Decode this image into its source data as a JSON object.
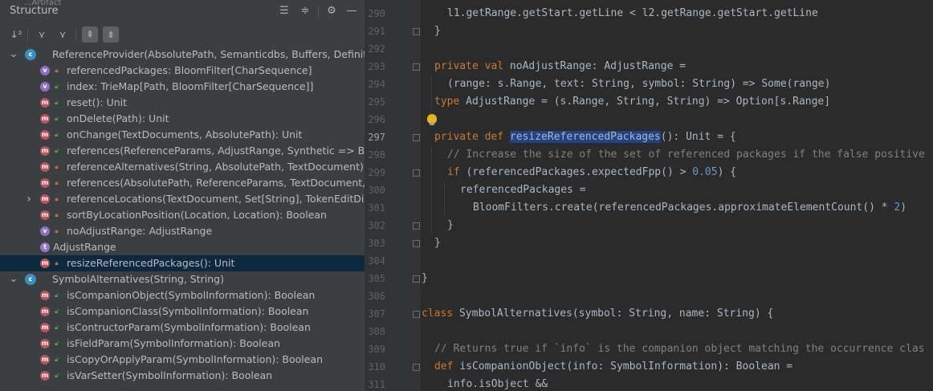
{
  "structure": {
    "title": "Structure",
    "hidden_title_fragment": "...Artifact",
    "tree": [
      {
        "label": "ReferenceProvider(AbsolutePath, Semanticdbs, Buffers, Definiti",
        "kind": "class",
        "vis": "",
        "depth": 0,
        "arrow": "expanded"
      },
      {
        "label": "referencedPackages: BloomFilter[CharSequence]",
        "kind": "v",
        "vis": "private",
        "depth": 1
      },
      {
        "label": "index: TrieMap[Path, BloomFilter[CharSequence]]",
        "kind": "v",
        "vis": "public",
        "depth": 1
      },
      {
        "label": "reset(): Unit",
        "kind": "m",
        "vis": "public",
        "depth": 1
      },
      {
        "label": "onDelete(Path): Unit",
        "kind": "m",
        "vis": "public",
        "depth": 1
      },
      {
        "label": "onChange(TextDocuments, AbsolutePath): Unit",
        "kind": "m",
        "vis": "public",
        "depth": 1
      },
      {
        "label": "references(ReferenceParams, AdjustRange, Synthetic => Boo",
        "kind": "m",
        "vis": "public",
        "depth": 1
      },
      {
        "label": "referenceAlternatives(String, AbsolutePath, TextDocument):",
        "kind": "m",
        "vis": "private",
        "depth": 1
      },
      {
        "label": "references(AbsolutePath, ReferenceParams, TextDocument, T",
        "kind": "m",
        "vis": "private",
        "depth": 1
      },
      {
        "label": "referenceLocations(TextDocument, Set[String], TokenEditDis",
        "kind": "m",
        "vis": "private",
        "depth": 1,
        "arrow": "collapsed"
      },
      {
        "label": "sortByLocationPosition(Location, Location): Boolean",
        "kind": "m",
        "vis": "private",
        "depth": 1
      },
      {
        "label": "noAdjustRange: AdjustRange",
        "kind": "v",
        "vis": "private",
        "depth": 1
      },
      {
        "label": "AdjustRange",
        "kind": "t",
        "vis": "",
        "depth": 1
      },
      {
        "label": "resizeReferencedPackages(): Unit",
        "kind": "m",
        "vis": "private",
        "depth": 1,
        "selected": true
      },
      {
        "label": "SymbolAlternatives(String, String)",
        "kind": "class",
        "vis": "",
        "depth": 0,
        "arrow": "expanded"
      },
      {
        "label": "isCompanionObject(SymbolInformation): Boolean",
        "kind": "m",
        "vis": "public",
        "depth": 1
      },
      {
        "label": "isCompanionClass(SymbolInformation): Boolean",
        "kind": "m",
        "vis": "public",
        "depth": 1
      },
      {
        "label": "isContructorParam(SymbolInformation): Boolean",
        "kind": "m",
        "vis": "public",
        "depth": 1
      },
      {
        "label": "isFieldParam(SymbolInformation): Boolean",
        "kind": "m",
        "vis": "public",
        "depth": 1
      },
      {
        "label": "isCopyOrApplyParam(SymbolInformation): Boolean",
        "kind": "m",
        "vis": "public",
        "depth": 1
      },
      {
        "label": "isVarSetter(SymbolInformation): Boolean",
        "kind": "m",
        "vis": "public",
        "depth": 1
      }
    ]
  },
  "editor": {
    "current_line": "297",
    "lines": [
      {
        "n": "290",
        "indent": 2,
        "tokens": [
          {
            "t": "l1.getRange.getStart.getLine < l2.getRange.getStart.getLine",
            "c": ""
          }
        ]
      },
      {
        "n": "291",
        "indent": 1,
        "tokens": [
          {
            "t": "}",
            "c": ""
          }
        ]
      },
      {
        "n": "292",
        "indent": 0,
        "tokens": []
      },
      {
        "n": "293",
        "indent": 1,
        "tokens": [
          {
            "t": "private val ",
            "c": "kw"
          },
          {
            "t": "noAdjustRange: AdjustRange =",
            "c": ""
          }
        ]
      },
      {
        "n": "294",
        "indent": 2,
        "tokens": [
          {
            "t": "(range: s.Range, text: String, symbol: String) => Some(range)",
            "c": ""
          }
        ]
      },
      {
        "n": "295",
        "indent": 1,
        "tokens": [
          {
            "t": "type ",
            "c": "kw"
          },
          {
            "t": "AdjustRange = (s.Range, String, String) => Option[s.Range]",
            "c": ""
          }
        ]
      },
      {
        "n": "296",
        "indent": 0,
        "tokens": []
      },
      {
        "n": "297",
        "indent": 1,
        "tokens": [
          {
            "t": "private def ",
            "c": "kw"
          },
          {
            "t": "resizeReferencedPackages",
            "c": "sel"
          },
          {
            "t": "(): Unit = {",
            "c": ""
          }
        ]
      },
      {
        "n": "298",
        "indent": 2,
        "tokens": [
          {
            "t": "// Increase the size of the set of referenced packages if the false positive",
            "c": "com"
          }
        ]
      },
      {
        "n": "299",
        "indent": 2,
        "tokens": [
          {
            "t": "if ",
            "c": "kw"
          },
          {
            "t": "(referencedPackages.expectedFpp() > ",
            "c": ""
          },
          {
            "t": "0.05",
            "c": "num"
          },
          {
            "t": ") {",
            "c": ""
          }
        ]
      },
      {
        "n": "300",
        "indent": 3,
        "tokens": [
          {
            "t": "referencedPackages =",
            "c": ""
          }
        ]
      },
      {
        "n": "301",
        "indent": 4,
        "tokens": [
          {
            "t": "BloomFilters.create(referencedPackages.approximateElementCount() * ",
            "c": ""
          },
          {
            "t": "2",
            "c": "num"
          },
          {
            "t": ")",
            "c": ""
          }
        ]
      },
      {
        "n": "302",
        "indent": 2,
        "tokens": [
          {
            "t": "}",
            "c": ""
          }
        ]
      },
      {
        "n": "303",
        "indent": 1,
        "tokens": [
          {
            "t": "}",
            "c": ""
          }
        ]
      },
      {
        "n": "304",
        "indent": 0,
        "tokens": []
      },
      {
        "n": "305",
        "indent": 0,
        "tokens": [
          {
            "t": "}",
            "c": ""
          }
        ]
      },
      {
        "n": "306",
        "indent": 0,
        "tokens": []
      },
      {
        "n": "307",
        "indent": 0,
        "tokens": [
          {
            "t": "class ",
            "c": "kw"
          },
          {
            "t": "SymbolAlternatives(symbol: String, name: String) {",
            "c": ""
          }
        ]
      },
      {
        "n": "308",
        "indent": 0,
        "tokens": []
      },
      {
        "n": "309",
        "indent": 1,
        "tokens": [
          {
            "t": "// Returns true if `info` is the companion object matching the occurrence clas",
            "c": "com"
          }
        ]
      },
      {
        "n": "310",
        "indent": 1,
        "tokens": [
          {
            "t": "def ",
            "c": "kw"
          },
          {
            "t": "isCompanionObject(info: SymbolInformation): Boolean =",
            "c": ""
          }
        ]
      },
      {
        "n": "311",
        "indent": 2,
        "tokens": [
          {
            "t": "info.isObject &&",
            "c": ""
          }
        ]
      }
    ]
  }
}
